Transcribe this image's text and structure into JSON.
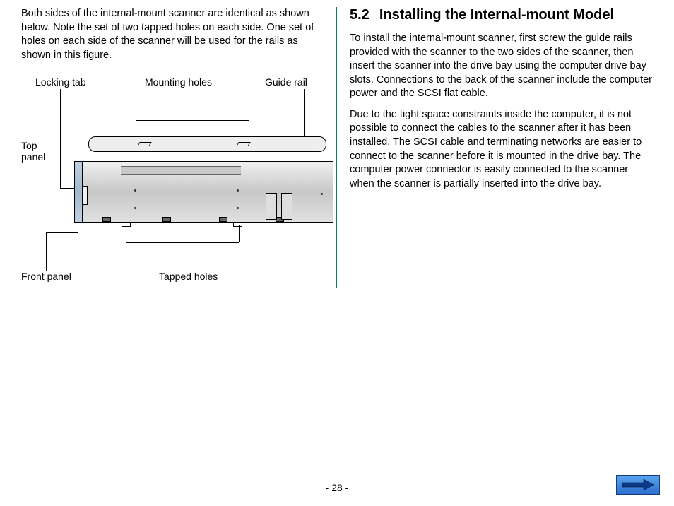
{
  "left": {
    "intro": "Both sides of the internal-mount scanner are identical as shown below.  Note the set of two tapped holes on each side.  One set of holes on each side of the scanner will be used for the rails as shown in this figure.",
    "labels": {
      "locking_tab": "Locking tab",
      "mounting_holes": "Mounting holes",
      "guide_rail": "Guide rail",
      "top_panel": "Top\npanel",
      "front_panel": "Front panel",
      "tapped_holes": "Tapped holes"
    }
  },
  "right": {
    "secnum": "5.2",
    "title": "Installing the Internal-mount Model",
    "p1": "To install the internal-mount scanner, first screw the guide rails provided with the scanner to the two sides of the scanner, then insert the scanner into the drive bay using the computer drive bay slots.  Connections to the back of the scanner include the computer power and the SCSI flat cable.",
    "p2": "Due to the tight space constraints inside the computer, it is not possible to connect the cables to the scanner after it has been installed.  The SCSI cable and terminating networks are easier to connect to the scanner before it is mounted in the drive bay.  The computer power connector is easily connected to the scanner when the scanner is partially inserted into the drive bay."
  },
  "page_number": "- 28 -"
}
